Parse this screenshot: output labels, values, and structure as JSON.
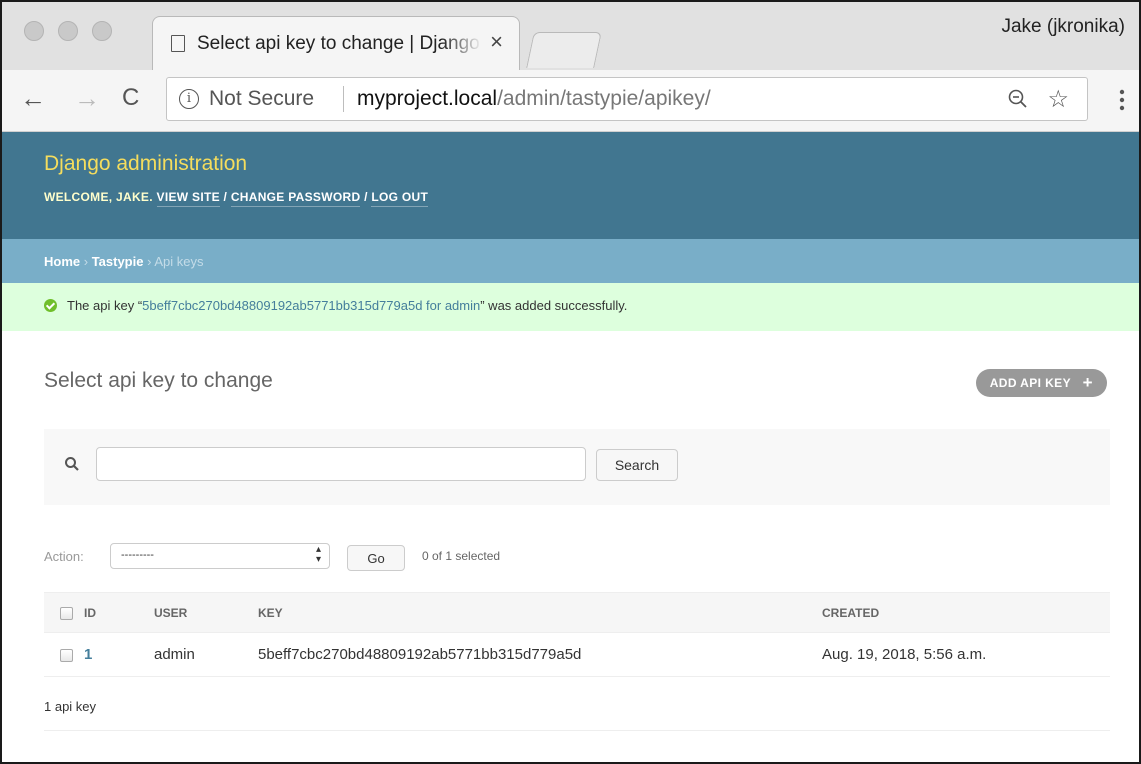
{
  "browser": {
    "tab_title": "Select api key to change | Django site admin",
    "tab_close": "×",
    "profile": "Jake (jkronika)",
    "back": "←",
    "forward": "→",
    "reload": "C",
    "security_label": "Not Secure",
    "url_host": "myproject.local",
    "url_path": "/admin/tastypie/apikey/",
    "star": "☆",
    "menu": "⋮"
  },
  "header": {
    "branding": "Django administration",
    "welcome": "Welcome, ",
    "username": "jake",
    "view_site": "View site",
    "change_password": "Change password",
    "log_out": "Log out",
    "sep": " / "
  },
  "breadcrumbs": {
    "home": "Home",
    "app": "Tastypie",
    "current": "Api keys",
    "sep": " › "
  },
  "message": {
    "prefix": "The api key “",
    "object": "5beff7cbc270bd48809192ab5771bb315d779a5d for admin",
    "suffix": "” was added successfully."
  },
  "content": {
    "title": "Select api key to change",
    "add_button": "ADD API KEY",
    "add_plus": "+"
  },
  "search": {
    "value": "",
    "button": "Search"
  },
  "actions": {
    "label": "Action:",
    "selected_option": "---------",
    "go": "Go",
    "selection_count": "0 of 1 selected"
  },
  "table": {
    "columns": [
      "ID",
      "USER",
      "KEY",
      "CREATED"
    ],
    "rows": [
      {
        "id": "1",
        "user": "admin",
        "key": "5beff7cbc270bd48809192ab5771bb315d779a5d",
        "created": "Aug. 19, 2018, 5:56 a.m."
      }
    ]
  },
  "paginator": "1 api key"
}
